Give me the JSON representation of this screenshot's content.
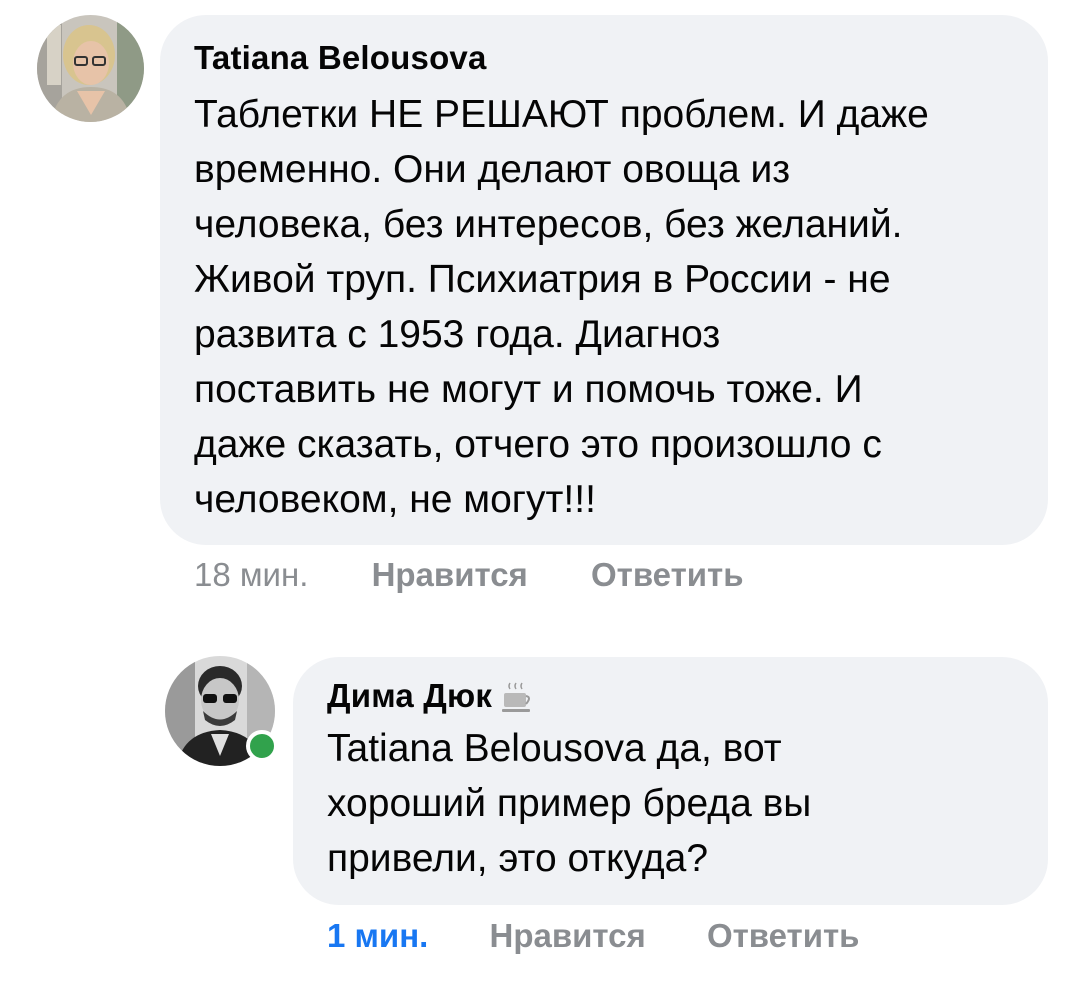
{
  "comments": [
    {
      "author": "Tatiana Belousova",
      "text": "Таблетки НЕ РЕШАЮТ проблем. И даже\nвременно. Они делают овоща из\nчеловека, без интересов, без желаний.\nЖивой труп. Психиатрия в России - не\nразвита с 1953 года. Диагноз\nпоставить не могут и помочь тоже. И\nдаже сказать, отчего это произошло с\nчеловеком, не могут!!!",
      "time": "18 мин.",
      "like_label": "Нравится",
      "reply_label": "Ответить"
    },
    {
      "author": "Дима Дюк",
      "badge_icon": "coffee-cup-icon",
      "text": "Tatiana Belousova да, вот\nхороший пример бреда вы\nпривели, это откуда?",
      "time": "1 мин.",
      "like_label": "Нравится",
      "reply_label": "Ответить",
      "online": true
    }
  ],
  "colors": {
    "bubble": "#f0f2f5",
    "meta": "#8a8d91",
    "fresh_time": "#1877f2",
    "online": "#31a24c"
  }
}
